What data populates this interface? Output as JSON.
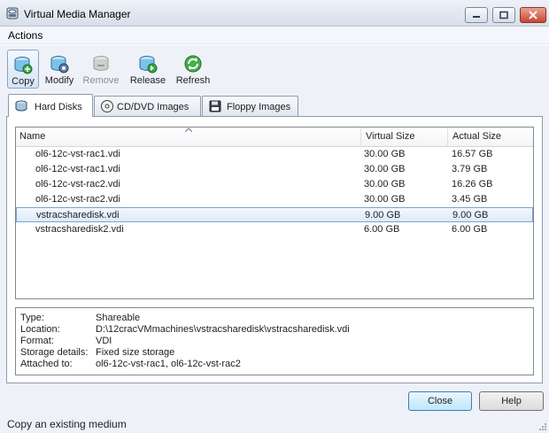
{
  "window": {
    "title": "Virtual Media Manager",
    "controls": {
      "minimize": "minimize",
      "maximize": "maximize",
      "close": "close"
    }
  },
  "menubar": {
    "actions_label": "Actions"
  },
  "toolbar": {
    "copy_label": "Copy",
    "modify_label": "Modify",
    "remove_label": "Remove",
    "release_label": "Release",
    "refresh_label": "Refresh"
  },
  "tabs": [
    {
      "label": "Hard Disks",
      "icon": "hard-disk-icon",
      "selected": true
    },
    {
      "label": "CD/DVD Images",
      "icon": "cd-dvd-icon",
      "selected": false
    },
    {
      "label": "Floppy Images",
      "icon": "floppy-icon",
      "selected": false
    }
  ],
  "table": {
    "columns": [
      "Name",
      "Virtual Size",
      "Actual Size"
    ],
    "sort_indicator": "ascending",
    "rows": [
      {
        "name": "ol6-12c-vst-rac1.vdi",
        "virtual_size": "30.00 GB",
        "actual_size": "16.57 GB",
        "selected": false
      },
      {
        "name": "ol6-12c-vst-rac1.vdi",
        "virtual_size": "30.00 GB",
        "actual_size": "3.79 GB",
        "selected": false
      },
      {
        "name": "ol6-12c-vst-rac2.vdi",
        "virtual_size": "30.00 GB",
        "actual_size": "16.26 GB",
        "selected": false
      },
      {
        "name": "ol6-12c-vst-rac2.vdi",
        "virtual_size": "30.00 GB",
        "actual_size": "3.45 GB",
        "selected": false
      },
      {
        "name": "vstracsharedisk.vdi",
        "virtual_size": "9.00 GB",
        "actual_size": "9.00 GB",
        "selected": true
      },
      {
        "name": "vstracsharedisk2.vdi",
        "virtual_size": "6.00 GB",
        "actual_size": "6.00 GB",
        "selected": false
      }
    ]
  },
  "details": {
    "type_label": "Type:",
    "type_value": "Shareable",
    "location_label": "Location:",
    "location_value": "D:\\12cracVMmachines\\vstracsharedisk\\vstracsharedisk.vdi",
    "format_label": "Format:",
    "format_value": "VDI",
    "storage_label": "Storage details:",
    "storage_value": "Fixed size storage",
    "attached_label": "Attached to:",
    "attached_value": "ol6-12c-vst-rac1, ol6-12c-vst-rac2"
  },
  "buttons": {
    "close_label": "Close",
    "help_label": "Help"
  },
  "status": {
    "text": "Copy an existing medium"
  },
  "colors": {
    "accent": "#3c7fb1",
    "selection": "#dfeafa",
    "window_bg": "#eef2f8"
  }
}
